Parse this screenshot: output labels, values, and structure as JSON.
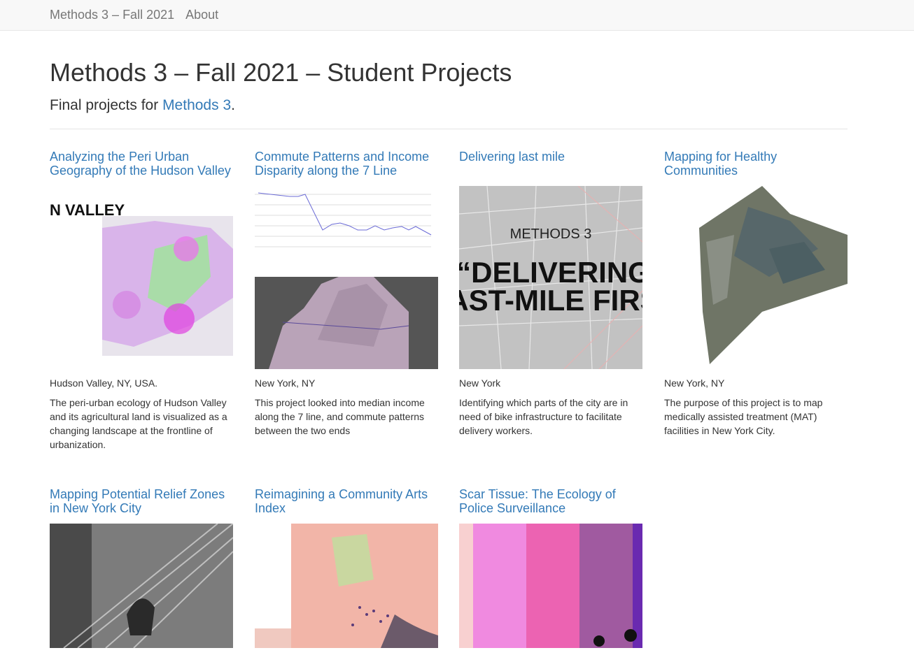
{
  "nav": {
    "brand": "Methods 3 – Fall 2021",
    "about": "About"
  },
  "header": {
    "title": "Methods 3 – Fall 2021 – Student Projects",
    "lead_prefix": "Final projects for ",
    "lead_link": "Methods 3",
    "lead_suffix": "."
  },
  "projects": [
    {
      "title": "Analyzing the Peri Urban Geography of the Hudson Valley",
      "location": "Hudson Valley, NY, USA.",
      "description": "The peri-urban ecology of Hudson Valley and its agricultural land is visualized as a changing landscape at the frontline of urbanization.",
      "thumb_text": "N VALLEY"
    },
    {
      "title": "Commute Patterns and Income Disparity along the 7 Line",
      "location": "New York, NY",
      "description": "This project looked into median income along the 7 line, and commute patterns between the two ends"
    },
    {
      "title": "Delivering last mile",
      "location": "New York",
      "description": "Identifying which parts of the city are in need of bike infrastructure to facilitate delivery workers.",
      "thumb_line1": "METHODS 3",
      "thumb_line2": "“DELIVERING",
      "thumb_line3": "AST-MILE FIRS"
    },
    {
      "title": "Mapping for Healthy Communities",
      "location": "New York, NY",
      "description": "The purpose of this project is to map medically assisted treatment (MAT) facilities in New York City."
    },
    {
      "title": "Mapping Potential Relief Zones in New York City"
    },
    {
      "title": "Reimagining a Community Arts Index"
    },
    {
      "title": "Scar Tissue: The Ecology of Police Surveillance"
    }
  ]
}
